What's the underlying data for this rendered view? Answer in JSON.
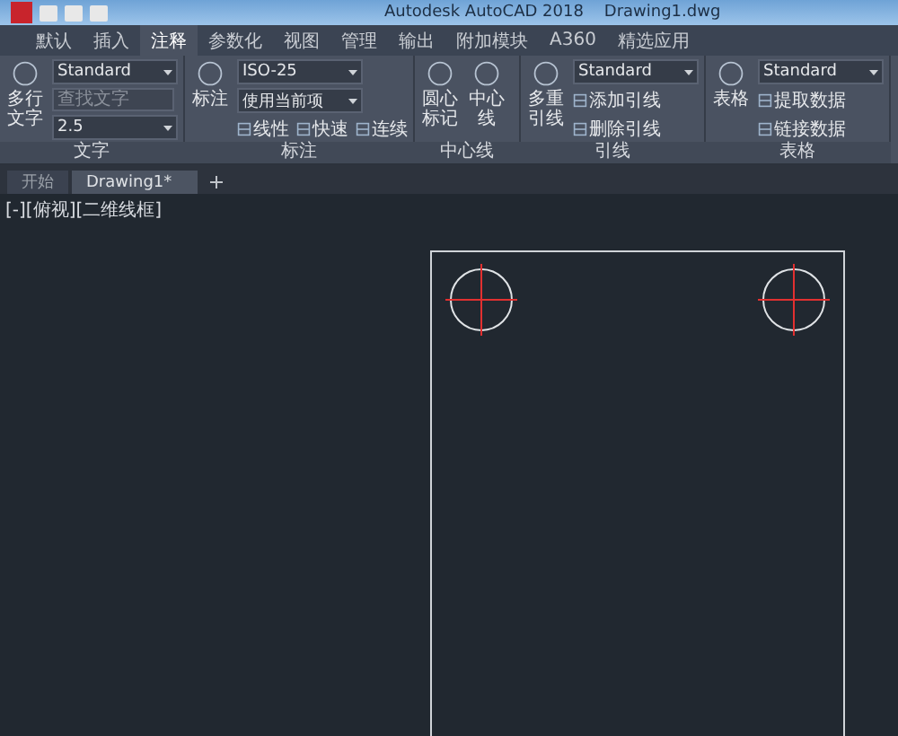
{
  "window": {
    "title": "Autodesk AutoCAD 2018    Drawing1.dwg"
  },
  "ribbon_tabs": [
    {
      "label": "默认",
      "selected": false
    },
    {
      "label": "插入",
      "selected": false
    },
    {
      "label": "注释",
      "selected": true
    },
    {
      "label": "参数化",
      "selected": false
    },
    {
      "label": "视图",
      "selected": false
    },
    {
      "label": "管理",
      "selected": false
    },
    {
      "label": "输出",
      "selected": false
    },
    {
      "label": "附加模块",
      "selected": false
    },
    {
      "label": "A360",
      "selected": false
    },
    {
      "label": "精选应用",
      "selected": false
    }
  ],
  "panels": [
    {
      "title": "文字",
      "large": [
        "多行文字"
      ],
      "rows": [
        [
          {
            "kind": "combo",
            "value": "Standard"
          }
        ],
        [
          {
            "kind": "field",
            "placeholder": "查找文字"
          }
        ],
        [
          {
            "kind": "combo",
            "value": "2.5"
          }
        ]
      ]
    },
    {
      "title": "标注",
      "large": [
        "标注"
      ],
      "rows": [
        [
          {
            "kind": "combo",
            "value": "ISO-25"
          }
        ],
        [
          {
            "kind": "combo",
            "value": "使用当前项"
          }
        ],
        [
          {
            "kind": "tool",
            "label": "线性"
          },
          {
            "kind": "tool",
            "label": "快速"
          },
          {
            "kind": "tool",
            "label": "连续"
          }
        ]
      ]
    },
    {
      "title": "中心线",
      "large": [
        "圆心标记",
        "中心线"
      ]
    },
    {
      "title": "引线",
      "large": [
        "多重引线"
      ],
      "rows": [
        [
          {
            "kind": "combo",
            "value": "Standard"
          }
        ],
        [
          {
            "kind": "tool",
            "label": "添加引线"
          }
        ],
        [
          {
            "kind": "tool",
            "label": "删除引线"
          }
        ]
      ]
    },
    {
      "title": "表格",
      "large": [
        "表格"
      ],
      "rows": [
        [
          {
            "kind": "combo",
            "value": "Standard"
          }
        ],
        [
          {
            "kind": "tool",
            "label": "提取数据"
          }
        ],
        [
          {
            "kind": "tool",
            "label": "链接数据"
          }
        ]
      ]
    }
  ],
  "file_tabs": [
    {
      "label": "开始",
      "selected": false
    },
    {
      "label": "Drawing1*",
      "selected": true
    }
  ],
  "viewport_label": "[-][俯视][二维线框]"
}
